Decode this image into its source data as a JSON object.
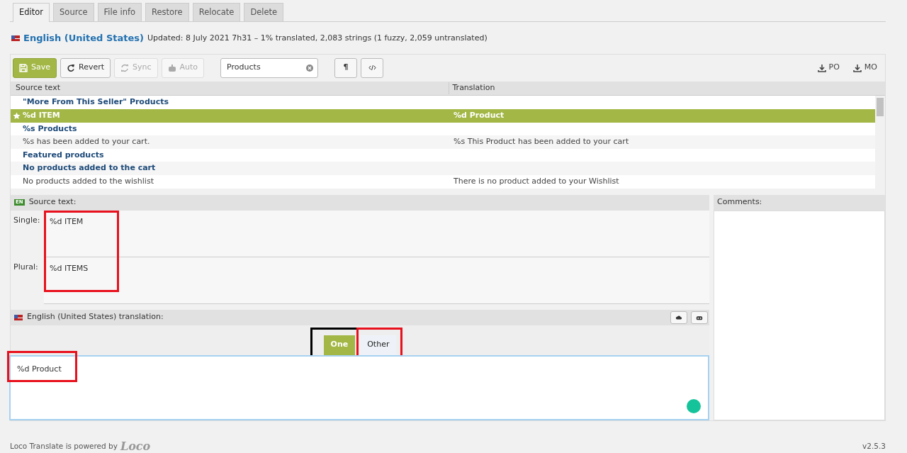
{
  "tabs": [
    {
      "label": "Editor",
      "selected": true
    },
    {
      "label": "Source",
      "selected": false
    },
    {
      "label": "File info",
      "selected": false
    },
    {
      "label": "Restore",
      "selected": false
    },
    {
      "label": "Relocate",
      "selected": false
    },
    {
      "label": "Delete",
      "selected": false
    }
  ],
  "header": {
    "language": "English (United States)",
    "summary": "Updated: 8 July 2021 7h31 – 1% translated, 2,083 strings (1 fuzzy, 2,059 untranslated)"
  },
  "toolbar": {
    "buttons": [
      {
        "label": "Save",
        "kind": "save",
        "disabled": false
      },
      {
        "label": "Revert",
        "kind": "revert",
        "disabled": false
      },
      {
        "label": "Sync",
        "kind": "sync",
        "disabled": true
      },
      {
        "label": "Auto",
        "kind": "auto",
        "disabled": true
      }
    ],
    "search": {
      "value": "Products"
    },
    "toggles": [
      {
        "label": "¶",
        "kind": "pilcrow"
      },
      {
        "kind": "code"
      }
    ],
    "downloads": [
      "PO",
      "MO"
    ]
  },
  "table": {
    "columns": [
      "Source text",
      "Translation"
    ],
    "rows": [
      {
        "source": "\"More From This Seller\" Products",
        "untranslated": true,
        "selected": false,
        "starred": false
      },
      {
        "source": "%d ITEM",
        "translation": "%d Product",
        "untranslated": false,
        "selected": true,
        "starred": true
      },
      {
        "source": "%s Products",
        "untranslated": true,
        "selected": false,
        "starred": false
      },
      {
        "source": "%s has been added to your cart.",
        "translation": "%s This Product has been added to your cart",
        "untranslated": false,
        "selected": false,
        "starred": false
      },
      {
        "source": "Featured products",
        "untranslated": true,
        "selected": false,
        "starred": false
      },
      {
        "source": "No products added to the cart",
        "untranslated": true,
        "selected": false,
        "starred": false
      },
      {
        "source": "No products added to the wishlist",
        "translation": "There is no product added to your Wishlist",
        "untranslated": false,
        "selected": false,
        "starred": false
      }
    ]
  },
  "source_panel": {
    "lang_badge": "EN",
    "title": "Source text:",
    "forms": [
      {
        "label": "Single:",
        "text": "%d ITEM"
      },
      {
        "label": "Plural:",
        "text": "%d ITEMS"
      }
    ]
  },
  "translation_panel": {
    "title": "English (United States) translation:",
    "plural_tabs": [
      {
        "label": "One",
        "selected": true
      },
      {
        "label": "Other",
        "selected": false
      }
    ],
    "text": "%d Product"
  },
  "annotations": [
    {
      "kind": "source",
      "color": "#e8101c"
    },
    {
      "kind": "one",
      "color": "#000000"
    },
    {
      "kind": "other",
      "color": "#e8101c"
    },
    {
      "kind": "translation",
      "color": "#e8101c"
    }
  ],
  "comments": {
    "title": "Comments:"
  },
  "footer": {
    "credit": "Loco Translate is powered by",
    "logo": "Loco",
    "version": "v2.5.3"
  }
}
